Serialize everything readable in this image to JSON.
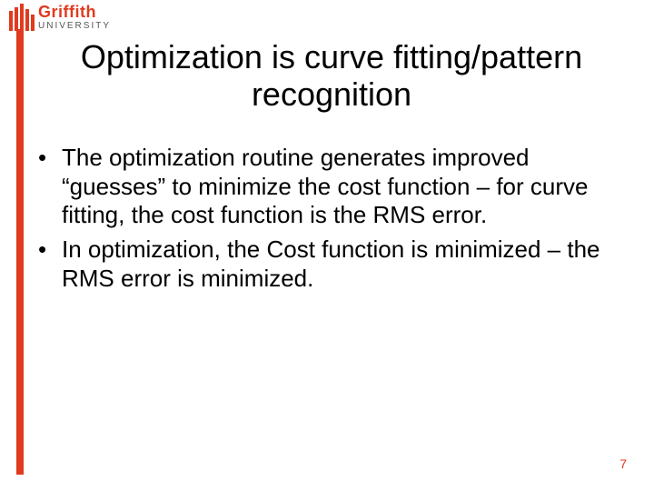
{
  "logo": {
    "name": "Griffith",
    "subname": "UNIVERSITY"
  },
  "title": "Optimization is curve fitting/pattern recognition",
  "bullets": [
    "The optimization routine generates improved “guesses” to minimize the cost function – for curve fitting, the cost function is the RMS error.",
    "In optimization, the Cost function is minimized – the RMS error is minimized."
  ],
  "page_number": "7"
}
